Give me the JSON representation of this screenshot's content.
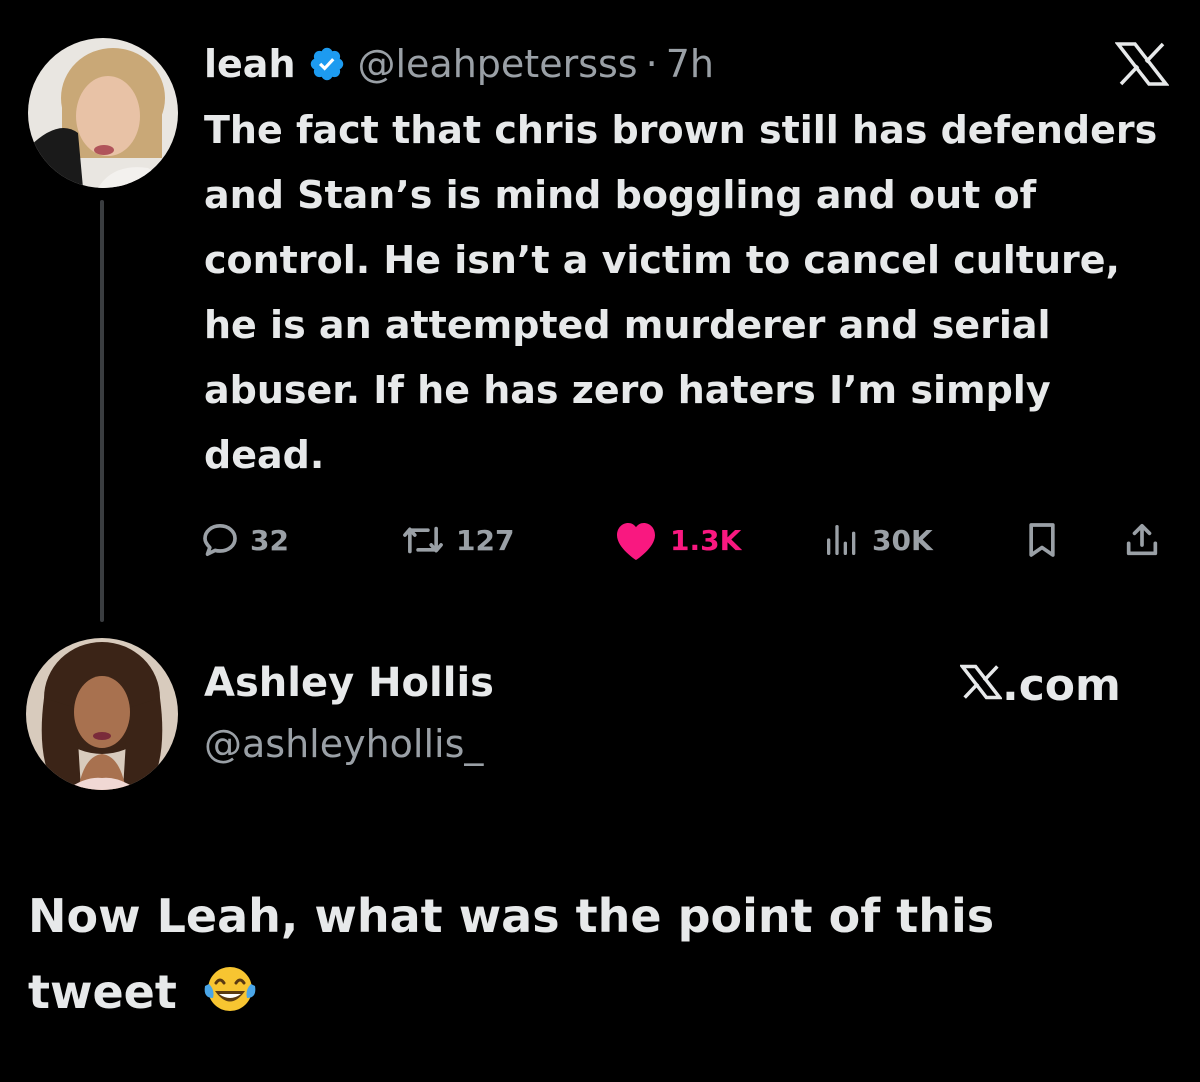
{
  "tweet": {
    "display_name": "leah",
    "handle": "@leahpetersss",
    "separator": "·",
    "time": "7h",
    "text": "The fact that chris brown still has defenders and Stan’s is mind boggling and out of control. He isn’t a victim to cancel culture, he is an attempted murderer and serial abuser. If he has zero haters I’m simply dead.",
    "stats": {
      "replies": "32",
      "reposts": "127",
      "likes": "1.3K",
      "views": "30K"
    },
    "icons": {
      "verified": "verified-badge-icon",
      "platform": "x-logo-icon",
      "reply": "reply-bubble-icon",
      "repost": "repost-arrows-icon",
      "like": "heart-filled-icon",
      "views": "bar-chart-icon",
      "bookmark": "bookmark-icon",
      "share": "share-upload-icon"
    }
  },
  "quoted_account": {
    "display_name": "Ashley Hollis",
    "handle": "@ashleyhollis_",
    "brand_suffix": ".com"
  },
  "caption": {
    "text": "Now Leah, what was the point of this tweet",
    "emoji": "😂"
  },
  "colors": {
    "background": "#000000",
    "primary_text": "#e7e9ea",
    "secondary_text": "#9aa0a6",
    "like_pink": "#f91880",
    "verified_blue": "#1d9bf0"
  }
}
